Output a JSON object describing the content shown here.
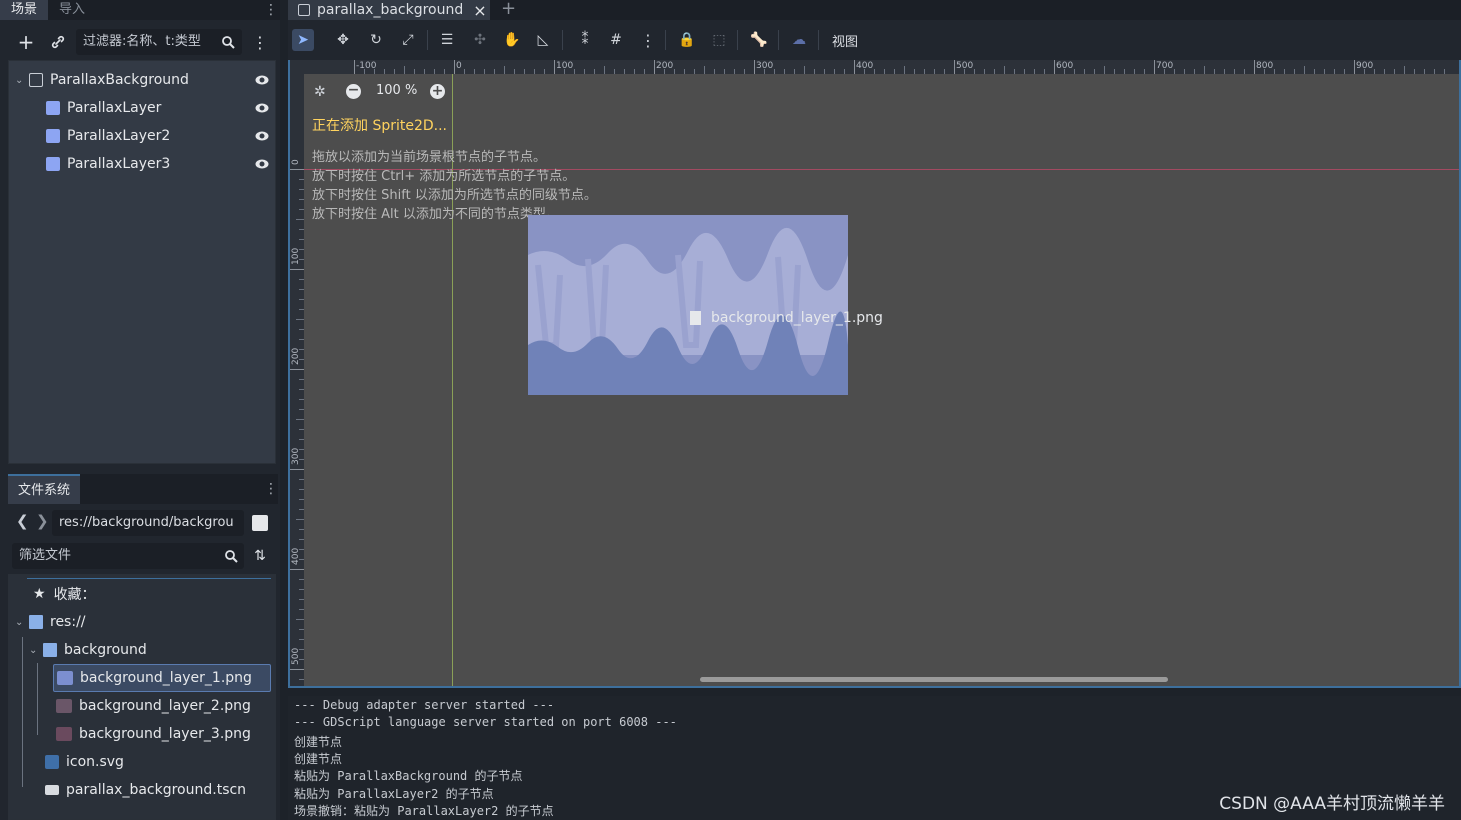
{
  "scene_dock": {
    "tabs": [
      "场景",
      "导入"
    ],
    "filter_placeholder": "过滤器:名称、t:类型",
    "nodes": [
      "ParallaxBackground",
      "ParallaxLayer",
      "ParallaxLayer2",
      "ParallaxLayer3"
    ]
  },
  "fs_dock": {
    "tab": "文件系统",
    "path": "res://background/backgrou",
    "filter_placeholder": "筛选文件",
    "favorites_label": "收藏：",
    "res_label": "res://",
    "folder": "background",
    "files": [
      "background_layer_1.png",
      "background_layer_2.png",
      "background_layer_3.png"
    ],
    "root_files": [
      "icon.svg",
      "parallax_background.tscn"
    ],
    "selected_file": "background_layer_1.png"
  },
  "editor_tab": {
    "title": "parallax_background",
    "close": "×",
    "add": "+"
  },
  "toolbar": {
    "view_menu": "视图"
  },
  "viewport": {
    "zoom": "100 %",
    "adding_text": "正在添加 Sprite2D...",
    "hints": [
      "拖放以添加为当前场景根节点的子节点。",
      "放下时按住 Ctrl+ 添加为所选节点的子节点。",
      "放下时按住 Shift 以添加为所选节点的同级节点。",
      "放下时按住 Alt 以添加为不同的节点类型。"
    ],
    "drag_file": "background_layer_1.png",
    "ruler_h": [
      "-100",
      "0",
      "100",
      "200",
      "300",
      "400",
      "500",
      "600",
      "700",
      "800",
      "900"
    ],
    "ruler_v": [
      "0",
      "100",
      "200",
      "300",
      "400",
      "500"
    ]
  },
  "console": {
    "lines": [
      "--- Debug adapter server started ---",
      "--- GDScript language server started on port 6008 ---",
      "创建节点",
      "创建节点",
      "粘贴为 ParallaxBackground 的子节点",
      "粘贴为 ParallaxLayer2 的子节点",
      "场景撤销：粘贴为 ParallaxLayer2 的子节点"
    ]
  },
  "watermark": "CSDN @AAA羊村顶流懒羊羊",
  "colors": {
    "accent": "#3d6f9c",
    "node_blue": "#8da5f3",
    "warning": "#ffd35e",
    "selection": "#3b4a63"
  }
}
